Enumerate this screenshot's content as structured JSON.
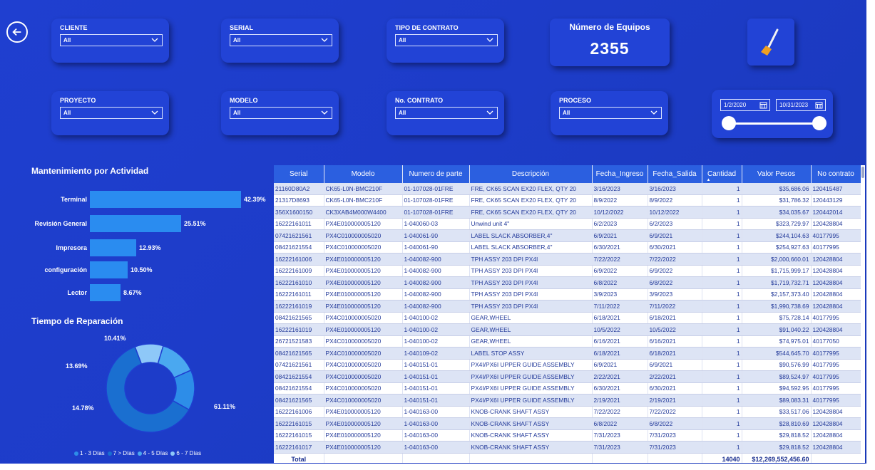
{
  "slicers": [
    {
      "label": "CLIENTE",
      "value": "All"
    },
    {
      "label": "SERIAL",
      "value": "All"
    },
    {
      "label": "TIPO DE CONTRATO",
      "value": "All"
    },
    {
      "label": "PROYECTO",
      "value": "All"
    },
    {
      "label": "MODELO",
      "value": "All"
    },
    {
      "label": "No. CONTRATO",
      "value": "All"
    },
    {
      "label": "PROCESO",
      "value": "All"
    }
  ],
  "card": {
    "title": "Número de Equipos",
    "value": "2355"
  },
  "date_range": {
    "start": "1/2/2020",
    "end": "10/31/2023"
  },
  "activity": {
    "title": "Mantenimiento por Actividad",
    "items": [
      {
        "label": "Terminal",
        "value": "42.39%"
      },
      {
        "label": "Revisión General",
        "value": "25.51%"
      },
      {
        "label": "Impresora",
        "value": "12.93%"
      },
      {
        "label": "configuración",
        "value": "10.50%"
      },
      {
        "label": "Lector",
        "value": "8.67%"
      }
    ]
  },
  "repair": {
    "title": "Tiempo de Reparación",
    "labels": [
      "10.41%",
      "13.69%",
      "14.78%",
      "61.11%"
    ],
    "legend": [
      "1 - 3 Días",
      "7 > Días",
      "4 - 5 Días",
      "6 - 7 Días"
    ]
  },
  "table": {
    "headers": [
      "Serial",
      "Modelo",
      "Numero de parte",
      "Descripción",
      "Fecha_Ingreso",
      "Fecha_Salida",
      "Cantidad",
      "Valor Pesos",
      "No contrato"
    ],
    "rows": [
      [
        "21160D80A2",
        "CK65-L0N-BMC210F",
        "01-107028-01FRE",
        "FRE, CK65 SCAN EX20 FLEX, QTY 20",
        "3/16/2023",
        "3/16/2023",
        "1",
        "$35,686.06",
        "120415487"
      ],
      [
        "21317D8693",
        "CK65-L0N-BMC210F",
        "01-107028-01FRE",
        "FRE, CK65 SCAN EX20 FLEX, QTY 20",
        "8/9/2022",
        "8/9/2022",
        "1",
        "$31,786.32",
        "120443129"
      ],
      [
        "356X1600150",
        "CK3XAB4M000W4400",
        "01-107028-01FRE",
        "FRE, CK65 SCAN EX20 FLEX, QTY 20",
        "10/12/2022",
        "10/12/2022",
        "1",
        "$34,035.67",
        "120442014"
      ],
      [
        "16222161011",
        "PX4E010000005120",
        "1-040060-03",
        "Unwind unit 4\"",
        "6/2/2023",
        "6/2/2023",
        "1",
        "$323,729.97",
        "120428804"
      ],
      [
        "07421621561",
        "PX4C010000005020",
        "1-040061-90",
        "LABEL SLACK ABSORBER,4\"",
        "6/9/2021",
        "6/9/2021",
        "1",
        "$244,104.63",
        "40177995"
      ],
      [
        "08421621554",
        "PX4C010000005020",
        "1-040061-90",
        "LABEL SLACK ABSORBER,4\"",
        "6/30/2021",
        "6/30/2021",
        "1",
        "$254,927.63",
        "40177995"
      ],
      [
        "16222161006",
        "PX4E010000005120",
        "1-040082-900",
        "TPH ASSY 203 DPI PX4I",
        "7/22/2022",
        "7/22/2022",
        "1",
        "$2,000,660.01",
        "120428804"
      ],
      [
        "16222161009",
        "PX4E010000005120",
        "1-040082-900",
        "TPH ASSY 203 DPI PX4I",
        "6/9/2022",
        "6/9/2022",
        "1",
        "$1,715,999.17",
        "120428804"
      ],
      [
        "16222161010",
        "PX4E010000005120",
        "1-040082-900",
        "TPH ASSY 203 DPI PX4I",
        "6/8/2022",
        "6/8/2022",
        "1",
        "$1,719,732.71",
        "120428804"
      ],
      [
        "16222161011",
        "PX4E010000005120",
        "1-040082-900",
        "TPH ASSY 203 DPI PX4I",
        "3/9/2023",
        "3/9/2023",
        "1",
        "$2,157,373.40",
        "120428804"
      ],
      [
        "16222161019",
        "PX4E010000005120",
        "1-040082-900",
        "TPH ASSY 203 DPI PX4I",
        "7/11/2022",
        "7/11/2022",
        "1",
        "$1,990,738.69",
        "120428804"
      ],
      [
        "08421621565",
        "PX4C010000005020",
        "1-040100-02",
        "GEAR,WHEEL",
        "6/18/2021",
        "6/18/2021",
        "1",
        "$75,728.14",
        "40177995"
      ],
      [
        "16222161019",
        "PX4E010000005120",
        "1-040100-02",
        "GEAR,WHEEL",
        "10/5/2022",
        "10/5/2022",
        "1",
        "$91,040.22",
        "120428804"
      ],
      [
        "26721521583",
        "PX4C010000005020",
        "1-040100-02",
        "GEAR,WHEEL",
        "6/16/2021",
        "6/16/2021",
        "1",
        "$74,975.01",
        "40177050"
      ],
      [
        "08421621565",
        "PX4C010000005020",
        "1-040109-02",
        "LABEL STOP ASSY",
        "6/18/2021",
        "6/18/2021",
        "1",
        "$544,645.70",
        "40177995"
      ],
      [
        "07421621561",
        "PX4C010000005020",
        "1-040151-01",
        "PX4I/PX6I UPPER GUIDE ASSEMBLY",
        "6/9/2021",
        "6/9/2021",
        "1",
        "$90,576.99",
        "40177995"
      ],
      [
        "08421621554",
        "PX4C010000005020",
        "1-040151-01",
        "PX4I/PX6I UPPER GUIDE ASSEMBLY",
        "2/22/2021",
        "2/22/2021",
        "1",
        "$89,524.97",
        "40177995"
      ],
      [
        "08421621554",
        "PX4C010000005020",
        "1-040151-01",
        "PX4I/PX6I UPPER GUIDE ASSEMBLY",
        "6/30/2021",
        "6/30/2021",
        "1",
        "$94,592.95",
        "40177995"
      ],
      [
        "08421621565",
        "PX4C010000005020",
        "1-040151-01",
        "PX4I/PX6I UPPER GUIDE ASSEMBLY",
        "2/19/2021",
        "2/19/2021",
        "1",
        "$89,083.31",
        "40177995"
      ],
      [
        "16222161006",
        "PX4E010000005120",
        "1-040163-00",
        "KNOB-CRANK SHAFT ASSY",
        "7/22/2022",
        "7/22/2022",
        "1",
        "$33,517.06",
        "120428804"
      ],
      [
        "16222161015",
        "PX4E010000005120",
        "1-040163-00",
        "KNOB-CRANK SHAFT ASSY",
        "6/8/2022",
        "6/8/2022",
        "1",
        "$28,810.69",
        "120428804"
      ],
      [
        "16222161015",
        "PX4E010000005120",
        "1-040163-00",
        "KNOB-CRANK SHAFT ASSY",
        "7/31/2023",
        "7/31/2023",
        "1",
        "$29,818.52",
        "120428804"
      ],
      [
        "16222161017",
        "PX4E010000005120",
        "1-040163-00",
        "KNOB-CRANK SHAFT ASSY",
        "7/31/2023",
        "7/31/2023",
        "1",
        "$29,818.52",
        "120428804"
      ]
    ],
    "total": {
      "label": "Total",
      "cantidad": "14040",
      "valor": "$12,269,552,456.60"
    }
  },
  "colors": {
    "background": "#1f3fd0",
    "bar": "#2a8cf0",
    "donut": [
      "#8ec8f8",
      "#4aa8f0",
      "#2d8de8",
      "#1a6fd0"
    ]
  }
}
